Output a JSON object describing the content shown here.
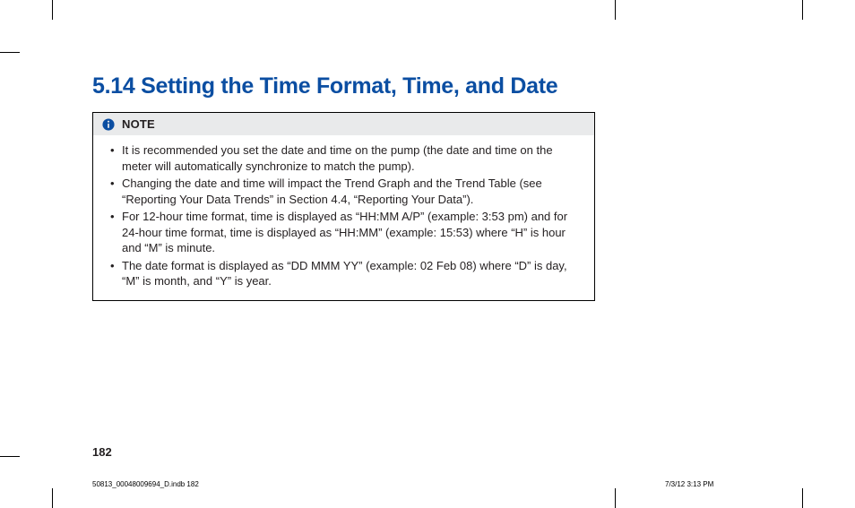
{
  "section": {
    "title": "5.14 Setting the Time Format, Time, and Date"
  },
  "note": {
    "icon_name": "info-icon",
    "label": "NOTE",
    "items": [
      "It is recommended you set the date and time on the pump (the date and time on the meter will automatically synchronize to match the pump).",
      "Changing the date and time will impact the Trend Graph and the Trend Table (see “Reporting Your Data Trends” in Section 4.4, “Reporting Your Data”).",
      "For 12-hour time format, time is displayed as “HH:MM A/P” (example: 3:53 pm) and for 24-hour time format, time is displayed as “HH:MM” (example: 15:53) where “H” is hour and “M” is minute.",
      "The date format is displayed as “DD MMM YY” (example: 02 Feb 08) where “D” is day, “M” is month, and “Y” is year."
    ]
  },
  "page_number": "182",
  "imprint": {
    "filename": "50813_00048009694_D.indb   182",
    "timestamp": "7/3/12   3:13 PM"
  },
  "colors": {
    "heading": "#0b4ea2",
    "note_header_bg": "#e9eaeb"
  }
}
